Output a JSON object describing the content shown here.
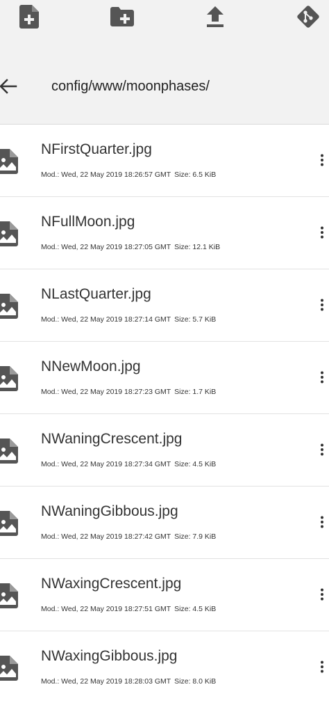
{
  "toolbar": {
    "buttons": [
      {
        "icon": "new-file-icon"
      },
      {
        "icon": "new-folder-icon"
      },
      {
        "icon": "upload-icon"
      },
      {
        "icon": "git-icon"
      }
    ]
  },
  "header": {
    "back_icon": "back-arrow-icon",
    "path": "config/www/moonphases/"
  },
  "colors": {
    "icon": "#555555",
    "header_bg": "#f2f2f2",
    "list_bg": "#ffffff",
    "divider": "#e2e2e2"
  },
  "files": [
    {
      "name": "NFirstQuarter.jpg",
      "modified": "Mod.: Wed, 22 May 2019 18:26:57 GMT",
      "size": "Size: 6.5 KiB"
    },
    {
      "name": "NFullMoon.jpg",
      "modified": "Mod.: Wed, 22 May 2019 18:27:05 GMT",
      "size": "Size: 12.1 KiB"
    },
    {
      "name": "NLastQuarter.jpg",
      "modified": "Mod.: Wed, 22 May 2019 18:27:14 GMT",
      "size": "Size: 5.7 KiB"
    },
    {
      "name": "NNewMoon.jpg",
      "modified": "Mod.: Wed, 22 May 2019 18:27:23 GMT",
      "size": "Size: 1.7 KiB"
    },
    {
      "name": "NWaningCrescent.jpg",
      "modified": "Mod.: Wed, 22 May 2019 18:27:34 GMT",
      "size": "Size: 4.5 KiB"
    },
    {
      "name": "NWaningGibbous.jpg",
      "modified": "Mod.: Wed, 22 May 2019 18:27:42 GMT",
      "size": "Size: 7.9 KiB"
    },
    {
      "name": "NWaxingCrescent.jpg",
      "modified": "Mod.: Wed, 22 May 2019 18:27:51 GMT",
      "size": "Size: 4.5 KiB"
    },
    {
      "name": "NWaxingGibbous.jpg",
      "modified": "Mod.: Wed, 22 May 2019 18:28:03 GMT",
      "size": "Size: 8.0 KiB"
    }
  ]
}
